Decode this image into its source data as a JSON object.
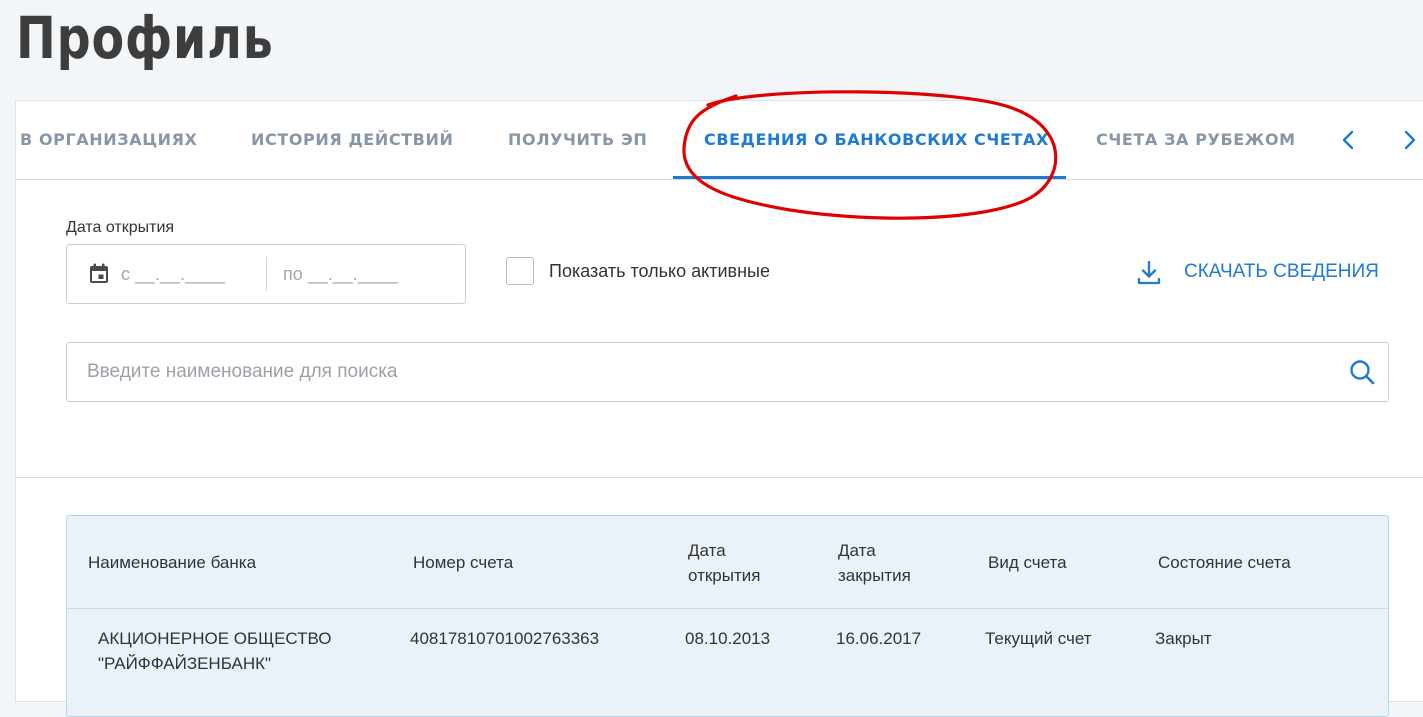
{
  "page": {
    "title": "Профиль"
  },
  "tabs": [
    {
      "label": "В ОРГАНИЗАЦИЯХ"
    },
    {
      "label": "ИСТОРИЯ ДЕЙСТВИЙ"
    },
    {
      "label": "ПОЛУЧИТЬ ЭП"
    },
    {
      "label": "СВЕДЕНИЯ О БАНКОВСКИХ СЧЕТАХ",
      "active": true
    },
    {
      "label": "СЧЕТА ЗА РУБЕЖОМ"
    }
  ],
  "filters": {
    "date_label": "Дата открытия",
    "date_from_placeholder": "с __.__.____",
    "date_to_placeholder": "по __.__.____",
    "active_only_label": "Показать только активные",
    "active_only_checked": false
  },
  "download": {
    "label": "СКАЧАТЬ СВЕДЕНИЯ"
  },
  "search": {
    "placeholder": "Введите наименование для поиска"
  },
  "table": {
    "headers": {
      "bank": "Наименование банка",
      "account": "Номер счета",
      "opened_l1": "Дата",
      "opened_l2": "открытия",
      "closed_l1": "Дата",
      "closed_l2": "закрытия",
      "type": "Вид счета",
      "status": "Состояние счета"
    },
    "rows": [
      {
        "bank_l1": "АКЦИОНЕРНОЕ ОБЩЕСТВО",
        "bank_l2": "\"РАЙФФАЙЗЕНБАНК\"",
        "account": "40817810701002763363",
        "opened": "08.10.2013",
        "closed": "16.06.2017",
        "type": "Текущий счет",
        "status": "Закрыт"
      }
    ]
  },
  "colors": {
    "accent": "#1f7ad1",
    "tab_inactive": "#8796a6",
    "annotation": "#e00000",
    "table_bg": "#eaf2f9"
  },
  "icons": [
    "calendar-icon",
    "download-icon",
    "search-icon",
    "chevron-left-icon",
    "chevron-right-icon"
  ]
}
